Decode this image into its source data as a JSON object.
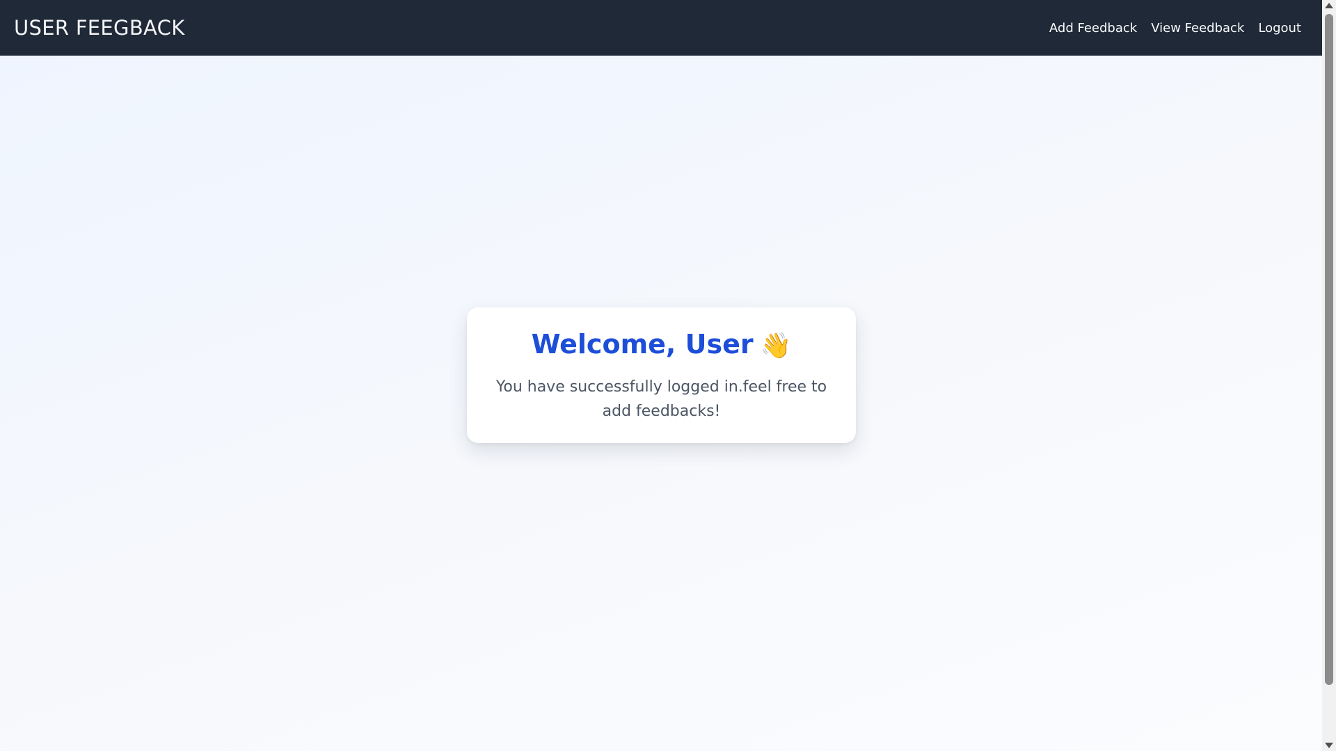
{
  "navbar": {
    "brand": "USER FEEGBACK",
    "links": [
      {
        "label": "Add Feedback"
      },
      {
        "label": "View Feedback"
      },
      {
        "label": "Logout"
      }
    ]
  },
  "welcome_card": {
    "title": "Welcome, User",
    "icon": "waving-hand-icon",
    "message": "You have successfully logged in.feel free to add feedbacks!"
  },
  "colors": {
    "navbar_bg": "#1f2937",
    "title": "#1d4ed8",
    "message": "#4b5563"
  }
}
